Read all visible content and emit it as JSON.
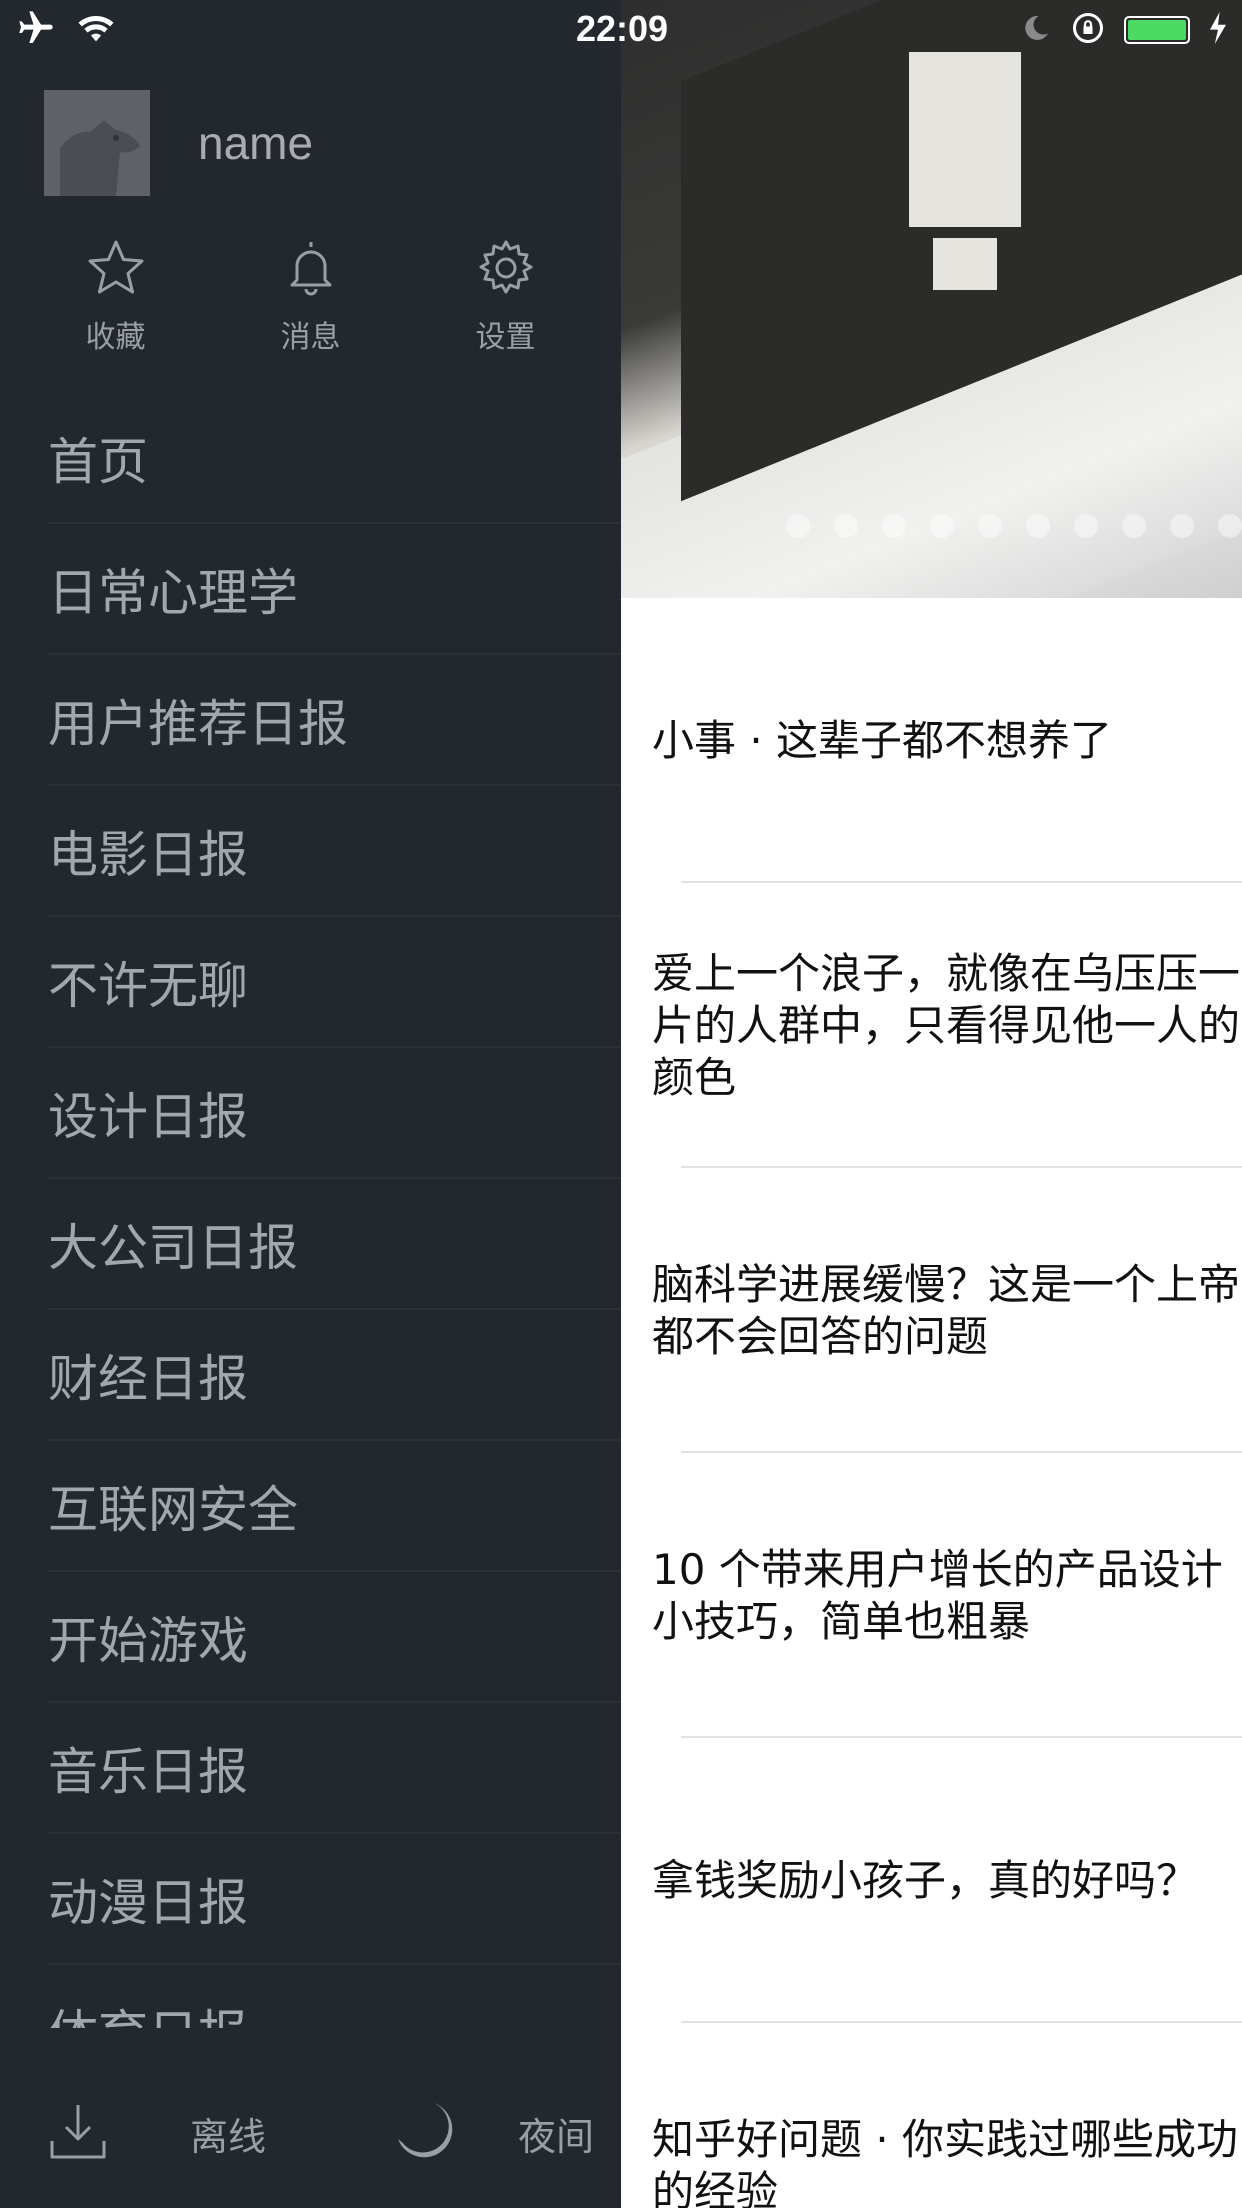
{
  "status_bar": {
    "time": "22:09",
    "icons": [
      "airplane-icon",
      "wifi-icon",
      "moon-icon",
      "rotation-lock-icon",
      "battery-icon",
      "charging-icon"
    ]
  },
  "profile": {
    "name": "name"
  },
  "quick_actions": [
    {
      "label": "收藏",
      "icon": "star-icon"
    },
    {
      "label": "消息",
      "icon": "bell-icon"
    },
    {
      "label": "设置",
      "icon": "gear-icon"
    }
  ],
  "menu": {
    "items": [
      "首页",
      "日常心理学",
      "用户推荐日报",
      "电影日报",
      "不许无聊",
      "设计日报",
      "大公司日报",
      "财经日报",
      "互联网安全",
      "开始游戏",
      "音乐日报",
      "动漫日报",
      "体育日报"
    ]
  },
  "footer": {
    "offline_label": "离线",
    "night_label": "夜间"
  },
  "banner": {
    "dot_count": 10
  },
  "news": [
    "小事 · 这辈子都不想养了",
    "爱上一个浪子，就像在乌压压一片的人群中，只看得见他一人的颜色",
    "脑科学进展缓慢？这是一个上帝都不会回答的问题",
    "10 个带来用户增长的产品设计小技巧，简单也粗暴",
    "拿钱奖励小孩子，真的好吗？",
    "知乎好问题 · 你实践过哪些成功的经验"
  ],
  "colors": {
    "drawer_bg": "#23272e",
    "drawer_text": "#9a9ea5",
    "content_bg": "#ffffff",
    "battery": "#4cd964"
  }
}
